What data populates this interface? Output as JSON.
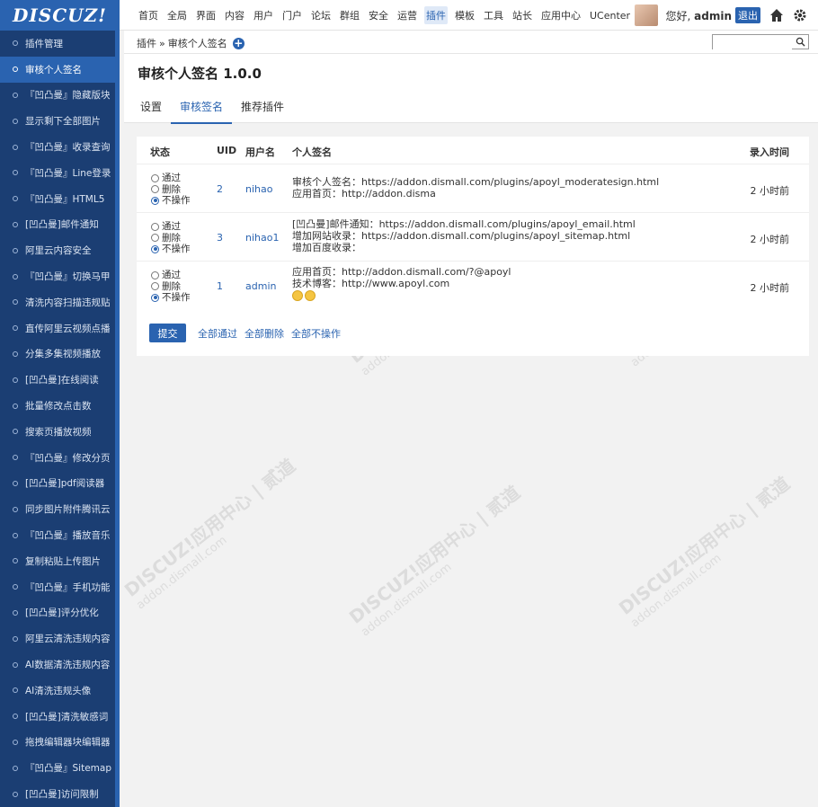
{
  "header": {
    "logo": "DISCUZ!",
    "nav": [
      "首页",
      "全局",
      "界面",
      "内容",
      "用户",
      "门户",
      "论坛",
      "群组",
      "安全",
      "运营",
      "插件",
      "模板",
      "工具",
      "站长",
      "应用中心",
      "UCenter"
    ],
    "active_nav_index": 10,
    "greeting_prefix": "您好,",
    "username": "admin",
    "logout_label": "退出",
    "icons": [
      "home-icon",
      "gear-icon"
    ]
  },
  "sidebar": {
    "items": [
      "插件管理",
      "审核个人签名",
      "『凹凸曼』隐藏版块",
      "显示剩下全部图片",
      "『凹凸曼』收录查询",
      "『凹凸曼』Line登录",
      "『凹凸曼』HTML5",
      "[凹凸曼]邮件通知",
      "阿里云内容安全",
      "『凹凸曼』切换马甲",
      "清洗内容扫描违规贴",
      "直传阿里云视频点播",
      "分集多集视频播放",
      "[凹凸曼]在线阅读",
      "批量修改点击数",
      "搜索页播放视频",
      "『凹凸曼』修改分页",
      "[凹凸曼]pdf阅读器",
      "同步图片附件腾讯云",
      "『凹凸曼』播放音乐",
      "复制粘贴上传图片",
      "『凹凸曼』手机功能",
      "[凹凸曼]评分优化",
      "阿里云清洗违规内容",
      "AI数据清洗违规内容",
      "AI清洗违规头像",
      "[凹凸曼]清洗敏感词",
      "拖拽编辑器块编辑器",
      "『凹凸曼』Sitemap",
      "[凹凸曼]访问限制"
    ],
    "active_index": 1
  },
  "breadcrumb": {
    "parent": "插件",
    "separator": "»",
    "current": "审核个人签名"
  },
  "search": {
    "value": "",
    "placeholder": ""
  },
  "page": {
    "title": "审核个人签名 1.0.0",
    "tabs": [
      "设置",
      "审核签名",
      "推荐插件"
    ],
    "active_tab": 1
  },
  "table": {
    "headers": {
      "status": "状态",
      "uid": "UID",
      "username": "用户名",
      "signature": "个人签名",
      "time": "录入时间"
    },
    "radio_labels": [
      "通过",
      "删除",
      "不操作"
    ],
    "rows": [
      {
        "uid": "2",
        "username": "nihao",
        "lines": [
          "审核个人签名：https://addon.dismall.com/plugins/apoyl_moderatesign.html",
          "应用首页：http://addon.disma"
        ],
        "time": "2 小时前",
        "selected": 2,
        "smileys": 0
      },
      {
        "uid": "3",
        "username": "nihao1",
        "lines": [
          "[凹凸曼]邮件通知：https://addon.dismall.com/plugins/apoyl_email.html",
          "增加网站收录：https://addon.dismall.com/plugins/apoyl_sitemap.html",
          "增加百度收录："
        ],
        "time": "2 小时前",
        "selected": 2,
        "smileys": 0
      },
      {
        "uid": "1",
        "username": "admin",
        "lines": [
          "应用首页：http://addon.dismall.com/?@apoyl",
          "技术博客：http://www.apoyl.com"
        ],
        "time": "2 小时前",
        "selected": 2,
        "smileys": 2
      }
    ]
  },
  "actions": {
    "submit": "提交",
    "all_pass": "全部通过",
    "all_delete": "全部删除",
    "all_none": "全部不操作"
  },
  "watermark": {
    "line1": "DISCUZ!应用中心 | 贰道",
    "line2": "addon.dismall.com"
  },
  "colors": {
    "accent": "#2a63b0",
    "sidebar_bg": "#1b3e73"
  }
}
